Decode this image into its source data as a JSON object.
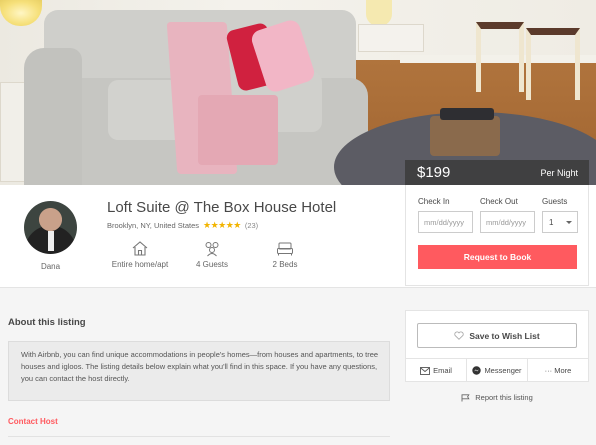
{
  "listing": {
    "title": "Loft Suite @ The Box House Hotel",
    "location": "Brooklyn, NY, United States",
    "stars": "★★★★★",
    "review_count": "(23)",
    "rating": 5
  },
  "host": {
    "name": "Dana"
  },
  "features": [
    {
      "label": "Entire home/apt",
      "icon": "home-icon"
    },
    {
      "label": "4 Guests",
      "icon": "guests-icon"
    },
    {
      "label": "2 Beds",
      "icon": "bed-icon"
    }
  ],
  "pricing": {
    "price": "$199",
    "per": "Per Night"
  },
  "booking": {
    "checkin_label": "Check In",
    "checkout_label": "Check Out",
    "guests_label": "Guests",
    "checkin_placeholder": "mm/dd/yyyy",
    "checkout_placeholder": "mm/dd/yyyy",
    "guests_value": "1",
    "request_button": "Request to Book"
  },
  "about": {
    "heading": "About this listing",
    "text": "With Airbnb, you can find unique accommodations in people's homes—from houses and apartments, to tree houses and igloos. The listing details below explain what you'll find in this space. If you have any questions, you can contact the host directly.",
    "contact_host": "Contact Host"
  },
  "actions": {
    "wishlist": "Save to Wish List",
    "email": "Email",
    "messenger": "Messenger",
    "more": "··· More",
    "report": "Report this listing"
  },
  "colors": {
    "accent": "#ff5a5f",
    "star": "#f2b400",
    "text": "#484848"
  }
}
